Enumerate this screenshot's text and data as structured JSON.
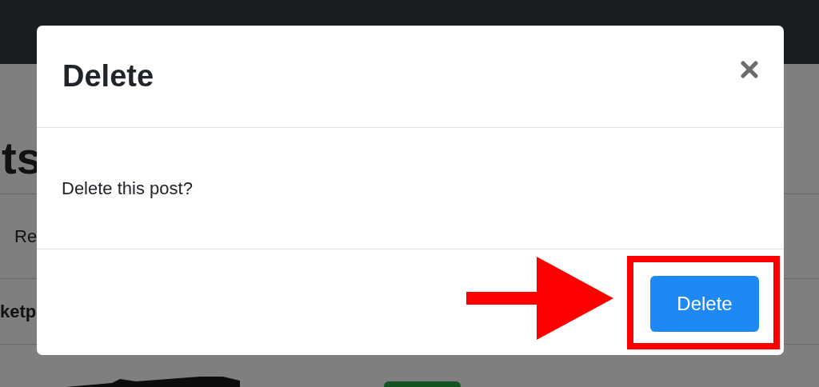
{
  "page": {
    "heading": "ts",
    "results_text": "Re",
    "section_label": "ketp"
  },
  "modal": {
    "title": "Delete",
    "message": "Delete this post?",
    "confirm_button": "Delete"
  }
}
